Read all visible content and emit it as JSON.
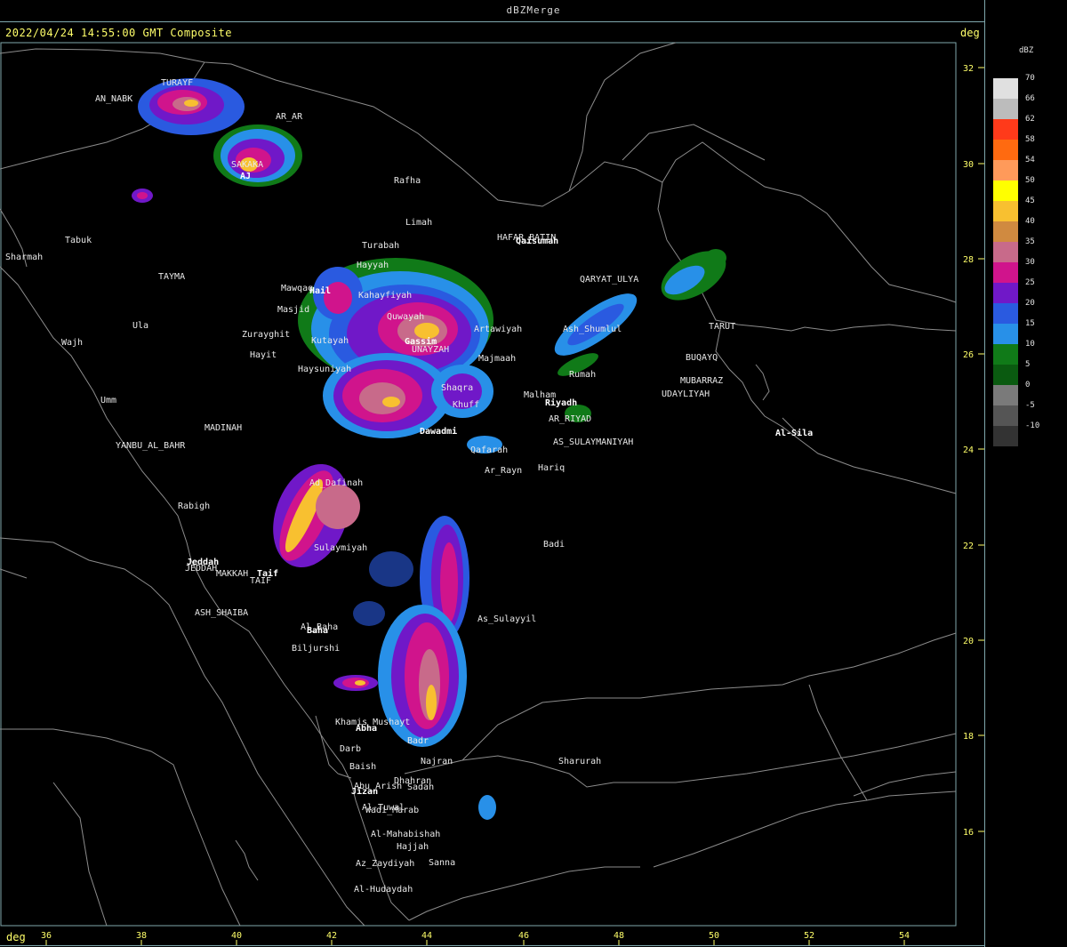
{
  "window_title": "dBZMerge",
  "header": {
    "timestamp": "2022/04/24 14:55:00 GMT Composite",
    "unit_top": "deg",
    "unit_bottom": "deg"
  },
  "legend": {
    "unit": "dBZ",
    "entries": [
      {
        "value": "70",
        "color": "#e0e0e0"
      },
      {
        "value": "66",
        "color": "#bcbcbc"
      },
      {
        "value": "62",
        "color": "#ff3a1a"
      },
      {
        "value": "58",
        "color": "#ff6a10"
      },
      {
        "value": "54",
        "color": "#ff9a5a"
      },
      {
        "value": "50",
        "color": "#ffff00"
      },
      {
        "value": "45",
        "color": "#f8c030"
      },
      {
        "value": "40",
        "color": "#d08a40"
      },
      {
        "value": "35",
        "color": "#c86a8a"
      },
      {
        "value": "30",
        "color": "#d0148c"
      },
      {
        "value": "25",
        "color": "#7018c8"
      },
      {
        "value": "20",
        "color": "#2a5ae0"
      },
      {
        "value": "15",
        "color": "#2890e8"
      },
      {
        "value": "10",
        "color": "#107a18"
      },
      {
        "value": "5",
        "color": "#0a5a10"
      },
      {
        "value": "0",
        "color": "#7a7a7a"
      },
      {
        "value": "-5",
        "color": "#555555"
      },
      {
        "value": "-10",
        "color": "#333333"
      }
    ]
  },
  "axes": {
    "lon_ticks": [
      "36",
      "38",
      "40",
      "42",
      "44",
      "46",
      "48",
      "50",
      "52",
      "54"
    ],
    "lat_ticks": [
      "32",
      "30",
      "28",
      "26",
      "24",
      "22",
      "20",
      "18",
      "16"
    ]
  },
  "places": [
    {
      "name": "TURAYF"
    },
    {
      "name": "AN_NABK"
    },
    {
      "name": "AR_AR"
    },
    {
      "name": "SAKAKA"
    },
    {
      "name": "AJ"
    },
    {
      "name": "Rafha"
    },
    {
      "name": "Limah"
    },
    {
      "name": "Tabuk"
    },
    {
      "name": "Sharmah"
    },
    {
      "name": "TAYMA"
    },
    {
      "name": "Turabah"
    },
    {
      "name": "Hayyah"
    },
    {
      "name": "Mawqaq"
    },
    {
      "name": "Hail"
    },
    {
      "name": "Kahayfiyah"
    },
    {
      "name": "Masjid"
    },
    {
      "name": "Quwayah"
    },
    {
      "name": "Ula"
    },
    {
      "name": "Zurayghit"
    },
    {
      "name": "Kutayah"
    },
    {
      "name": "Gassim"
    },
    {
      "name": "UNAYZAH"
    },
    {
      "name": "Artawiyah"
    },
    {
      "name": "Majmaah"
    },
    {
      "name": "Wajh"
    },
    {
      "name": "Hayit"
    },
    {
      "name": "Haysuniyah"
    },
    {
      "name": "Shaqra"
    },
    {
      "name": "Umm"
    },
    {
      "name": "MADINAH"
    },
    {
      "name": "Khuff"
    },
    {
      "name": "Dawadmi"
    },
    {
      "name": "YANBU_AL_BAHR"
    },
    {
      "name": "Qafarah"
    },
    {
      "name": "Ar_Rayn"
    },
    {
      "name": "HAFAR_BATIN"
    },
    {
      "name": "Qaisumah"
    },
    {
      "name": "QARYAT_ULYA"
    },
    {
      "name": "Ash_Shumlul"
    },
    {
      "name": "TARUT"
    },
    {
      "name": "BUQAYQ"
    },
    {
      "name": "Rumah"
    },
    {
      "name": "MUBARRAZ"
    },
    {
      "name": "UDAYLIYAH"
    },
    {
      "name": "Malham"
    },
    {
      "name": "Riyadh"
    },
    {
      "name": "AR_RIYAD"
    },
    {
      "name": "AS_SULAYMANIYAH"
    },
    {
      "name": "Hariq"
    },
    {
      "name": "Al-Sila"
    },
    {
      "name": "Ad_Dafinah"
    },
    {
      "name": "Rabigh"
    },
    {
      "name": "Sulaymiyah"
    },
    {
      "name": "Badi"
    },
    {
      "name": "Jeddah"
    },
    {
      "name": "JEDDAH"
    },
    {
      "name": "MAKKAH"
    },
    {
      "name": "Taif"
    },
    {
      "name": "TAIF"
    },
    {
      "name": "ASH_SHAIBA"
    },
    {
      "name": "As_Sulayyil"
    },
    {
      "name": "Al_Baha"
    },
    {
      "name": "Baha"
    },
    {
      "name": "Biljurshi"
    },
    {
      "name": "Khamis_Mushayt"
    },
    {
      "name": "Abha"
    },
    {
      "name": "Badr"
    },
    {
      "name": "Darb"
    },
    {
      "name": "Najran"
    },
    {
      "name": "Baish"
    },
    {
      "name": "Sharurah"
    },
    {
      "name": "Dhahran"
    },
    {
      "name": "Abu_Arish"
    },
    {
      "name": "Sadah"
    },
    {
      "name": "Jizan"
    },
    {
      "name": "Al-Tuwal"
    },
    {
      "name": "Wadi_Marab"
    },
    {
      "name": "Al-Mahabishah"
    },
    {
      "name": "Hajjah"
    },
    {
      "name": "Az_Zaydiyah"
    },
    {
      "name": "Sanna"
    },
    {
      "name": "Al-Hudaydah"
    }
  ]
}
